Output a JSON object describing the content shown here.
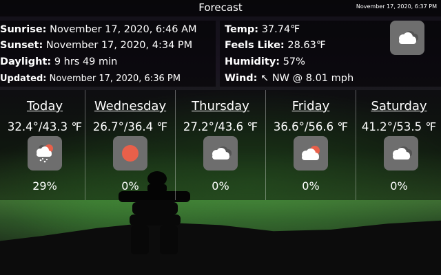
{
  "header": {
    "title": "Forecast",
    "datetime": "November 17, 2020, 6:37 PM"
  },
  "current": {
    "sunrise_label": "Sunrise:",
    "sunrise": "November 17, 2020, 6:46 AM",
    "sunset_label": "Sunset:",
    "sunset": "November 17, 2020, 4:34 PM",
    "daylight_label": "Daylight:",
    "daylight": "9 hrs 49 min",
    "updated_label": "Updated:",
    "updated": "November 17, 2020, 6:36 PM",
    "temp_label": "Temp:",
    "temp": "37.74℉",
    "feels_label": "Feels Like:",
    "feels": "28.63℉",
    "humidity_label": "Humidity:",
    "humidity": "57%",
    "wind_label": "Wind:",
    "wind": "↖ NW @ 8.01 mph",
    "icon": "cloudy-icon"
  },
  "days": [
    {
      "name": "Today",
      "temp": "32.4°/43.3 ℉",
      "pop": "29%",
      "icon": "snow-sun-cloud-icon"
    },
    {
      "name": "Wednesday",
      "temp": "26.7°/36.4 ℉",
      "pop": "0%",
      "icon": "sun-icon"
    },
    {
      "name": "Thursday",
      "temp": "27.2°/43.6 ℉",
      "pop": "0%",
      "icon": "cloudy-icon"
    },
    {
      "name": "Friday",
      "temp": "36.6°/56.6 ℉",
      "pop": "0%",
      "icon": "partly-cloudy-icon"
    },
    {
      "name": "Saturday",
      "temp": "41.2°/53.5 ℉",
      "pop": "0%",
      "icon": "cloudy-icon"
    }
  ],
  "colors": {
    "sun": "#e8604a",
    "cloud": "#ffffff",
    "cloud_back": "#555555",
    "icon_bg": "#6e6e6e"
  }
}
